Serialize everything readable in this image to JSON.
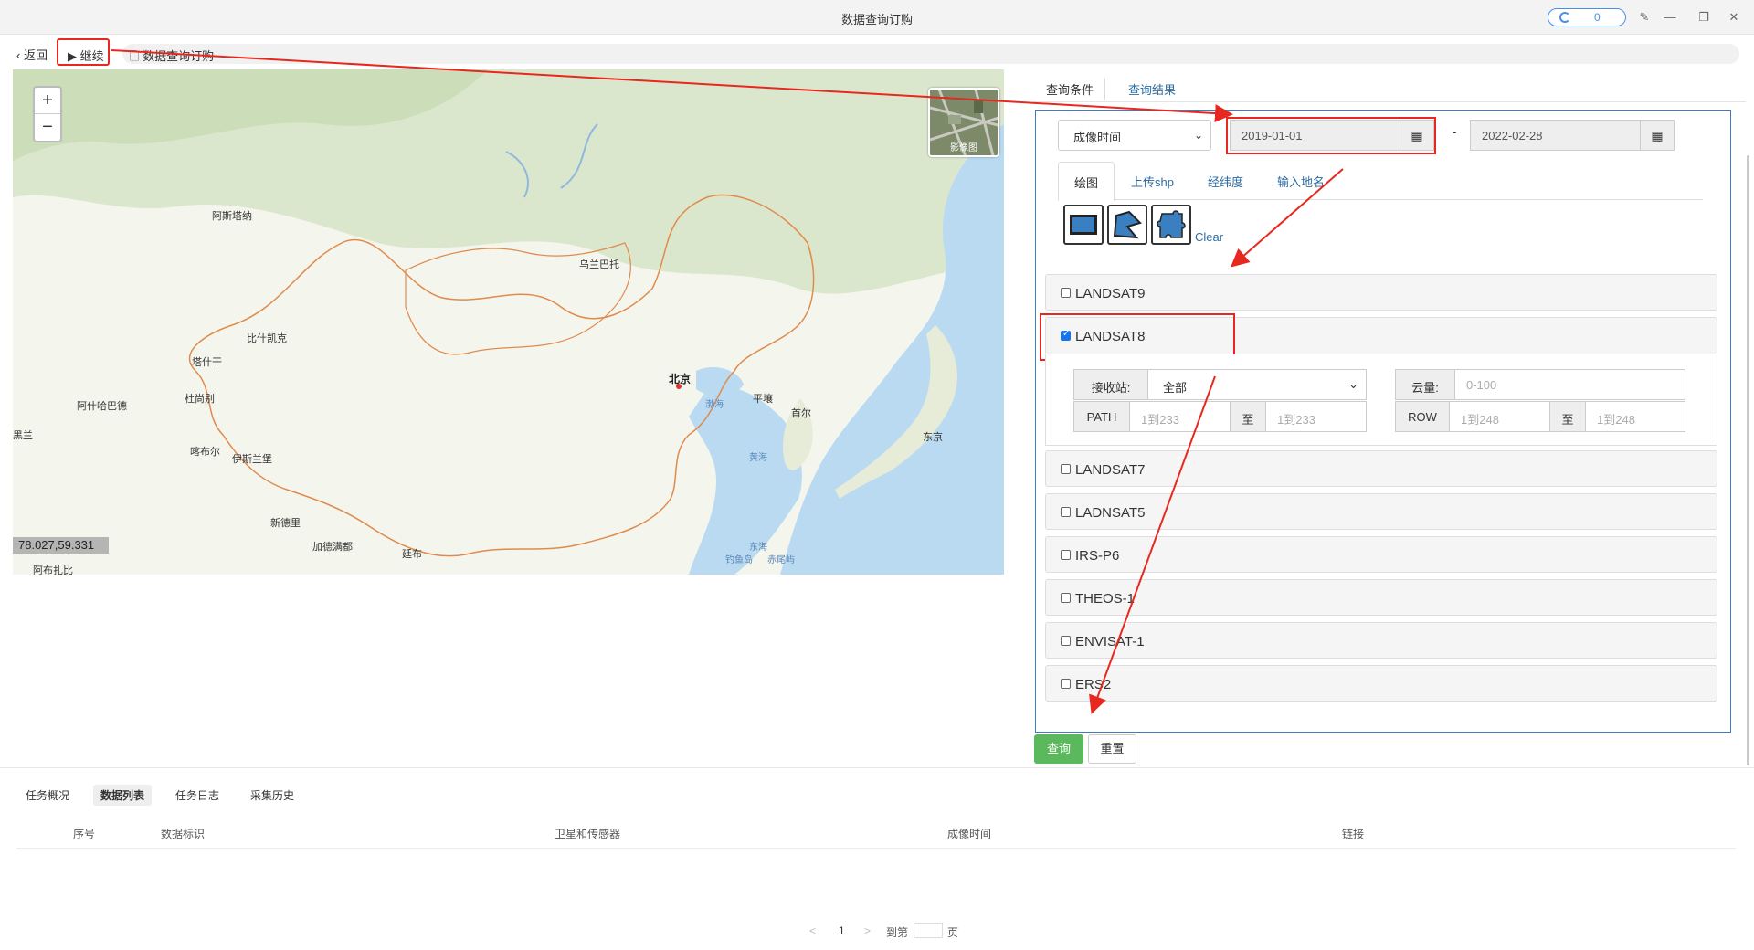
{
  "window": {
    "title": "数据查询订购",
    "counter": "0"
  },
  "nav": {
    "back": "返回",
    "continue": "继续",
    "tab": "数据查询订购"
  },
  "map": {
    "coord": "78.027,59.331",
    "layer_label": "影像图",
    "zoom_in": "+",
    "zoom_out": "−",
    "places": [
      "阿斯塔纳",
      "乌兰巴托",
      "比什凯克",
      "塔什干",
      "杜尚别",
      "阿什哈巴德",
      "喀布尔",
      "伊斯兰堡",
      "新德里",
      "加德满都",
      "廷布",
      "北京",
      "平壤",
      "首尔",
      "东京",
      "渤海",
      "黄海",
      "东海",
      "钓鱼岛",
      "赤尾屿",
      "阿布扎比",
      "黑兰"
    ]
  },
  "right_tabs": {
    "conditions": "查询条件",
    "results": "查询结果"
  },
  "date": {
    "type": "成像时间",
    "start": "2019-01-01",
    "sep": "-",
    "end": "2022-02-28"
  },
  "draw_tabs": [
    "绘图",
    "上传shp",
    "经纬度",
    "输入地名"
  ],
  "clear": "Clear",
  "satellites": [
    {
      "name": "LANDSAT9",
      "checked": false
    },
    {
      "name": "LANDSAT8",
      "checked": true
    },
    {
      "name": "LANDSAT7",
      "checked": false
    },
    {
      "name": "LADNSAT5",
      "checked": false
    },
    {
      "name": "IRS-P6",
      "checked": false
    },
    {
      "name": "THEOS-1",
      "checked": false
    },
    {
      "name": "ENVISAT-1",
      "checked": false
    },
    {
      "name": "ERS2",
      "checked": false
    }
  ],
  "landsat8_form": {
    "station_label": "接收站:",
    "station_value": "全部",
    "cloud_label": "云量:",
    "cloud_placeholder": "0-100",
    "path_label": "PATH",
    "path_from": "1到233",
    "to": "至",
    "path_to": "1到233",
    "row_label": "ROW",
    "row_from": "1到248",
    "row_to": "1到248"
  },
  "buttons": {
    "query": "查询",
    "reset": "重置"
  },
  "bottom_tabs": [
    "任务概况",
    "数据列表",
    "任务日志",
    "采集历史"
  ],
  "table_headers": [
    "序号",
    "数据标识",
    "卫星和传感器",
    "成像时间",
    "链接"
  ],
  "pager": {
    "prev": "<",
    "page": "1",
    "next": ">",
    "goto": "到第",
    "unit": "页"
  },
  "colors": {
    "accent": "#2e6da4",
    "highlight": "#e8281e",
    "query_btn": "#5cb85c"
  }
}
